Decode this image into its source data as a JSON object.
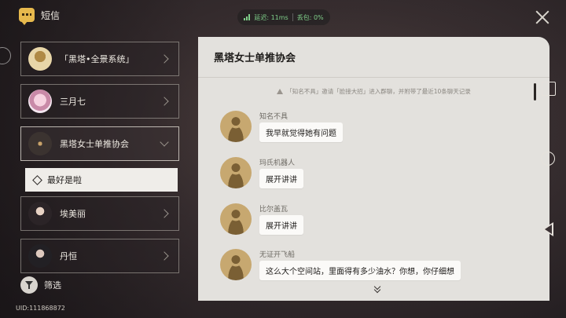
{
  "app": {
    "title": "短信",
    "icon": "message-icon"
  },
  "network": {
    "latency": "延迟: 11ms",
    "packet_loss": "丢包: 0%"
  },
  "contacts": [
    {
      "name": "「黑塔•全景系统」",
      "avatar": "gold-avatar"
    },
    {
      "name": "三月七",
      "avatar": "march7-avatar"
    },
    {
      "name": "黑塔女士单推协会",
      "avatar": "group-avatar",
      "expanded": true
    },
    {
      "name": "埃美丽",
      "avatar": "character-avatar"
    },
    {
      "name": "丹恒",
      "avatar": "character-avatar"
    }
  ],
  "sub_item": {
    "label": "最好是啦"
  },
  "filter": {
    "label": "筛选"
  },
  "uid": "UID:111868872",
  "chat": {
    "title": "黑塔女士单推协会",
    "system_note": "「知名不具」邀请「脸接大招」进入群聊，并附带了最近10条聊天记录",
    "messages": [
      {
        "sender": "知名不具",
        "text": "我早就觉得她有问题"
      },
      {
        "sender": "玛氏机器人",
        "text": "展开讲讲"
      },
      {
        "sender": "比尔盖瓦",
        "text": "展开讲讲"
      },
      {
        "sender": "无证开飞船",
        "text": "这么大个空间站，里面得有多少油水？你想，你仔细想"
      }
    ]
  },
  "colors": {
    "accent": "#e7b94d",
    "panel": "#e3e1dd",
    "bubble": "#fbfaf8",
    "network_ok": "#7fd08a"
  }
}
